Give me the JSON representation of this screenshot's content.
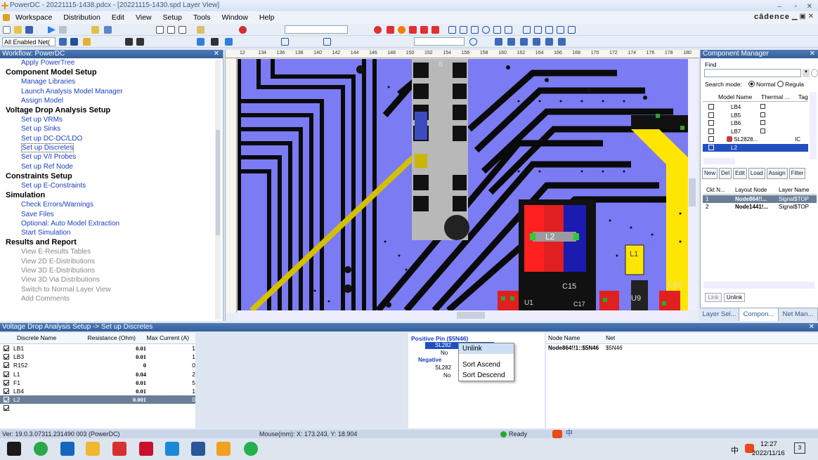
{
  "window": {
    "title": "PowerDC - 20221115-1438.pdcx - [20221115-1430.spd Layer View]",
    "brand": "cādence"
  },
  "menu": [
    "Workspace",
    "Distribution",
    "Edit",
    "View",
    "Setup",
    "Tools",
    "Window",
    "Help"
  ],
  "toolbar": {
    "net_filter_value": "All Enabled Net("
  },
  "workflow": {
    "title": "Workflow: PowerDC",
    "sections": [
      {
        "items": [
          {
            "label": "Apply PowerTree",
            "state": "link"
          }
        ]
      },
      {
        "header": "Component Model Setup",
        "items": [
          {
            "label": "Manage Libraries",
            "state": "link"
          },
          {
            "label": "Launch Analysis Model Manager",
            "state": "link"
          },
          {
            "label": "Assign Model",
            "state": "link"
          }
        ]
      },
      {
        "header": "Voltage Drop Analysis Setup",
        "items": [
          {
            "label": "Set up VRMs",
            "state": "link"
          },
          {
            "label": "Set up Sinks",
            "state": "link"
          },
          {
            "label": "Set up DC-DC/LDO",
            "state": "link"
          },
          {
            "label": "Set up Discretes",
            "state": "selected"
          },
          {
            "label": "Set up V/I Probes",
            "state": "link"
          },
          {
            "label": "Set up Ref Node",
            "state": "link"
          }
        ]
      },
      {
        "header": "Constraints Setup",
        "items": [
          {
            "label": "Set up E-Constraints",
            "state": "link"
          }
        ]
      },
      {
        "header": "Simulation",
        "items": [
          {
            "label": "Check Errors/Warnings",
            "state": "link"
          },
          {
            "label": "Save Files",
            "state": "link"
          },
          {
            "label": "Optional: Auto Model Extraction",
            "state": "link"
          },
          {
            "label": "Start Simulation",
            "state": "link"
          }
        ]
      },
      {
        "header": "Results and Report",
        "items": [
          {
            "label": "View E-Results Tables",
            "state": "disabled"
          },
          {
            "label": "View 2D E-Distributions",
            "state": "disabled"
          },
          {
            "label": "View 3D E-Distributions",
            "state": "disabled"
          },
          {
            "label": "View 3D Via Distributions",
            "state": "disabled"
          },
          {
            "label": "Switch to Normal Layer View",
            "state": "disabled"
          },
          {
            "label": "Add Comments",
            "state": "disabled"
          }
        ]
      }
    ]
  },
  "ruler_ticks": [
    "12",
    "134",
    "136",
    "138",
    "140",
    "142",
    "144",
    "146",
    "148",
    "150",
    "152",
    "154",
    "156",
    "158",
    "160",
    "162",
    "164",
    "166",
    "168",
    "170",
    "172",
    "174",
    "176",
    "178",
    "180"
  ],
  "board_labels": {
    "l2": "L2",
    "c15": "C15",
    "c14": "C14",
    "l1": "L1",
    "u9": "U9",
    "u10": "U1",
    "c17": "C17",
    "eight": "8"
  },
  "component_manager": {
    "title": "Component Manager",
    "find_label": "Find",
    "search_mode_label": "Search mode:",
    "mode_normal": "Normal",
    "mode_regular": "Regula",
    "columns": [
      "Model Name",
      "Thermal ...",
      "Tag"
    ],
    "rows": [
      {
        "name": "LB4",
        "tag": ""
      },
      {
        "name": "LB5",
        "tag": ""
      },
      {
        "name": "LB6",
        "tag": ""
      },
      {
        "name": "LB7",
        "tag": ""
      },
      {
        "name": "SL2828...",
        "tag": "IC"
      },
      {
        "name": "L2",
        "tag": ""
      }
    ],
    "buttons": [
      "New",
      "Del",
      "Edit",
      "Load",
      "Assign",
      "Filter"
    ],
    "conn_columns": [
      "Ckt N...",
      "Layout Node",
      "Layer Name"
    ],
    "conn_rows": [
      {
        "ckt": "1",
        "node": "Node864!!...",
        "layer": "Signal$TOP"
      },
      {
        "ckt": "2",
        "node": "Node1441!...",
        "layer": "Signal$TOP"
      }
    ],
    "link_buttons": [
      "Link",
      "Unlink"
    ]
  },
  "tabs": [
    "Layer Sel...",
    "Compon...",
    "Net Man..."
  ],
  "discretes": {
    "title": "Voltage Drop Analysis Setup -> Set up Discretes",
    "columns": [
      "Discrete Name",
      "Resistance (Ohm)",
      "Max Current (A)"
    ],
    "rows": [
      {
        "name": "LB1",
        "res": "0.01",
        "cur": "1"
      },
      {
        "name": "LB3",
        "res": "0.01",
        "cur": "1"
      },
      {
        "name": "R152",
        "res": "0",
        "cur": "0"
      },
      {
        "name": "L1",
        "res": "0.04",
        "cur": "2"
      },
      {
        "name": "F1",
        "res": "0.01",
        "cur": "5"
      },
      {
        "name": "LB4",
        "res": "0.01",
        "cur": "1"
      },
      {
        "name": "L2",
        "res": "0.001",
        "cur": "0"
      }
    ]
  },
  "pins": {
    "positive": "Positive Pin ($5N46)",
    "pos_child": "SL282",
    "pos_node": "No",
    "negative": "Negative",
    "neg_child": "SL282",
    "neg_node": "No"
  },
  "context_menu": [
    "Unlink",
    "Sort Ascend",
    "Sort Descend"
  ],
  "node_table": {
    "columns": [
      "Node Name",
      "Net"
    ],
    "rows": [
      {
        "node": "Node864!!1::$5N46",
        "net": "$5N46"
      }
    ]
  },
  "status": {
    "version": "Ver: 19.0.3.07311.231490  003 (PowerDC)",
    "mouse": "Mouse(mm): X: 173.243, Y: 18.904",
    "ready": "Ready"
  },
  "taskbar": {
    "ime": "中",
    "time": "12:27",
    "date": "2022/11/16",
    "notify": "3"
  }
}
